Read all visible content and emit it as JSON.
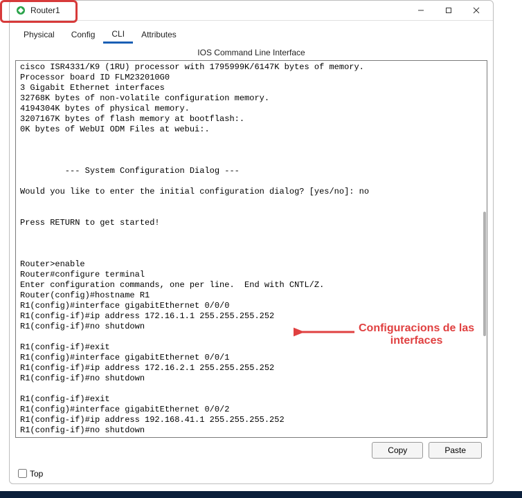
{
  "window_title": "Router1",
  "tabs": {
    "physical": "Physical",
    "config": "Config",
    "cli": "CLI",
    "attributes": "Attributes"
  },
  "panel_title": "IOS Command Line Interface",
  "cli_output": "cisco ISR4331/K9 (1RU) processor with 1795999K/6147K bytes of memory.\nProcessor board ID FLM232010G0\n3 Gigabit Ethernet interfaces\n32768K bytes of non-volatile configuration memory.\n4194304K bytes of physical memory.\n3207167K bytes of flash memory at bootflash:.\n0K bytes of WebUI ODM Files at webui:.\n\n\n\n         --- System Configuration Dialog ---\n\nWould you like to enter the initial configuration dialog? [yes/no]: no\n\n\nPress RETURN to get started!\n\n\n\nRouter>enable\nRouter#configure terminal\nEnter configuration commands, one per line.  End with CNTL/Z.\nRouter(config)#hostname R1\nR1(config)#interface gigabitEthernet 0/0/0\nR1(config-if)#ip address 172.16.1.1 255.255.255.252\nR1(config-if)#no shutdown\n\nR1(config-if)#exit\nR1(config)#interface gigabitEthernet 0/0/1\nR1(config-if)#ip address 172.16.2.1 255.255.255.252\nR1(config-if)#no shutdown\n\nR1(config-if)#exit\nR1(config)#interface gigabitEthernet 0/0/2\nR1(config-if)#ip address 192.168.41.1 255.255.255.252\nR1(config-if)#no shutdown",
  "buttons": {
    "copy": "Copy",
    "paste": "Paste"
  },
  "footer": {
    "top_label": "Top",
    "top_checked": false
  },
  "annotation": {
    "line1": "Configuracions de las",
    "line2": "interfaces"
  }
}
